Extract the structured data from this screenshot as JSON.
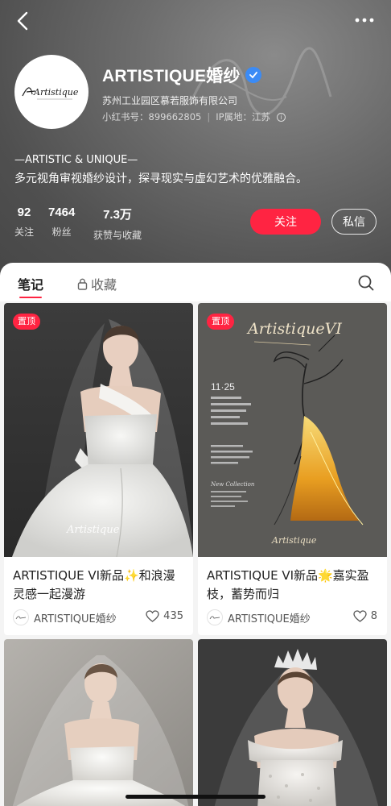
{
  "profile": {
    "name": "ARTISTIQUE婚纱",
    "logo_text": "Artistique",
    "company": "苏州工业园区慕若服饰有限公司",
    "redbook_id": "小红书号：899662805",
    "ip_location": "IP属地：江苏",
    "bio_line1": "—ARTISTIC & UNIQUE—",
    "bio_line2": "多元视角审视婚纱设计，探寻现实与虚幻艺术的优雅融合。",
    "stats": [
      {
        "value": "92",
        "label": "关注"
      },
      {
        "value": "7464",
        "label": "粉丝"
      },
      {
        "value": "7.3万",
        "label": "获赞与收藏"
      }
    ],
    "follow_label": "关注",
    "message_label": "私信"
  },
  "tabs": {
    "notes": "笔记",
    "collections": "收藏"
  },
  "feed": [
    {
      "pinned": "置顶",
      "title": "ARTISTIQUE VI新品✨和浪漫灵感一起漫游",
      "author": "ARTISTIQUE婚纱",
      "likes": "435"
    },
    {
      "pinned": "置顶",
      "title": "ARTISTIQUE VI新品🌟嘉实盈枝，蓄势而归",
      "author": "ARTISTIQUE婚纱",
      "likes": "8",
      "poster_title": "ArtistiqueVI",
      "poster_date": "11·25",
      "poster_subtitle": "New Collection"
    },
    {
      "title": "",
      "author": "",
      "likes": ""
    },
    {
      "title": "",
      "author": "",
      "likes": ""
    }
  ],
  "colors": {
    "accent": "#ff2442",
    "verify": "#3b8bf5"
  },
  "icons": [
    "back-arrow-icon",
    "more-icon",
    "verified-icon",
    "info-icon",
    "lock-icon",
    "search-icon",
    "heart-icon"
  ]
}
